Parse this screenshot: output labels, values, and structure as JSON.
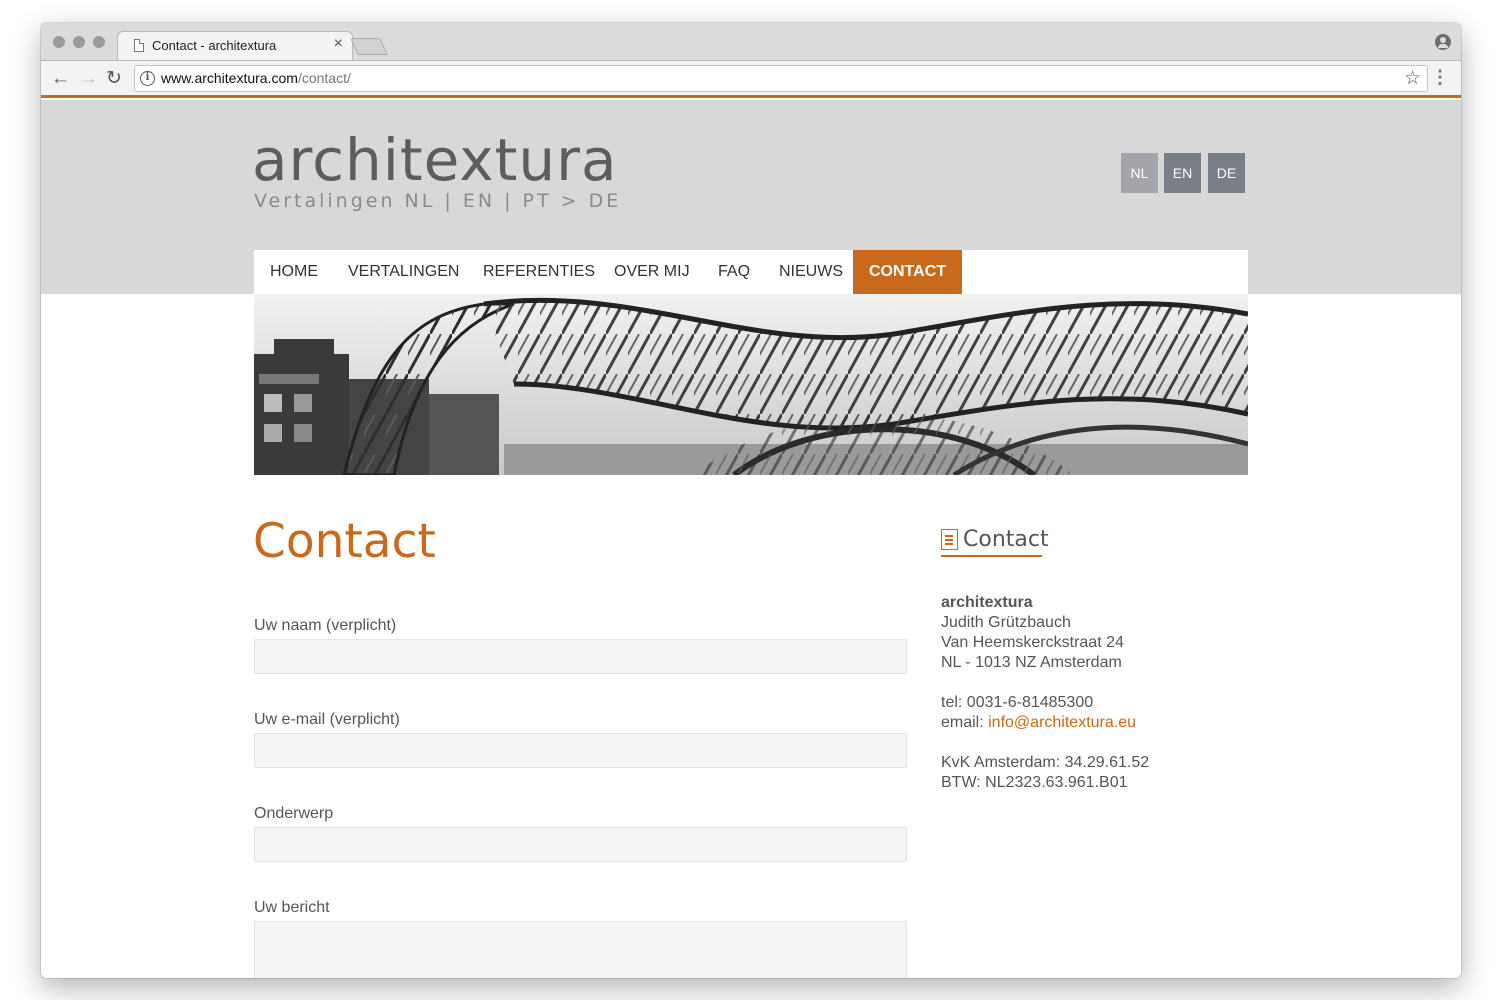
{
  "browser": {
    "tab_title": "Contact - architextura",
    "tab_close": "×",
    "url_host": "www.architextura.com",
    "url_path": "/contact/",
    "info_glyph": "i",
    "star_glyph": "☆",
    "menu_glyph": "⋮",
    "back_glyph": "←",
    "forward_glyph": "→",
    "reload_glyph": "↻"
  },
  "site": {
    "logo": "architextura",
    "tagline": "Vertalingen NL | EN | PT > DE",
    "languages": [
      "NL",
      "EN",
      "DE"
    ],
    "nav": [
      "HOME",
      "VERTALINGEN",
      "REFERENTIES",
      "OVER MIJ",
      "FAQ",
      "NIEUWS",
      "CONTACT"
    ],
    "active_nav": "CONTACT"
  },
  "form": {
    "title": "Contact",
    "name_label": "Uw naam (verplicht)",
    "email_label": "Uw e-mail (verplicht)",
    "subject_label": "Onderwerp",
    "message_label": "Uw bericht"
  },
  "sidebar": {
    "title": "Contact",
    "company": "architextura",
    "person": "Judith Grützbauch",
    "street": "Van Heemskerckstraat 24",
    "city": "NL - 1013 NZ Amsterdam",
    "tel": "tel: 0031-6-81485300",
    "email_prefix": "email: ",
    "email": "info@architextura.eu",
    "kvk": "KvK Amsterdam: 34.29.61.52",
    "btw": "BTW: NL2323.63.961.B01"
  },
  "colors": {
    "accent": "#c8691c",
    "header_band": "#d8d8d8",
    "lang_active": "#a3a5ab",
    "lang_inactive": "#7a7e86"
  },
  "icons": [
    "document-icon",
    "info-icon",
    "star-icon",
    "menu-icon",
    "profile-icon",
    "back-arrow-icon",
    "forward-arrow-icon",
    "reload-icon",
    "close-icon"
  ]
}
